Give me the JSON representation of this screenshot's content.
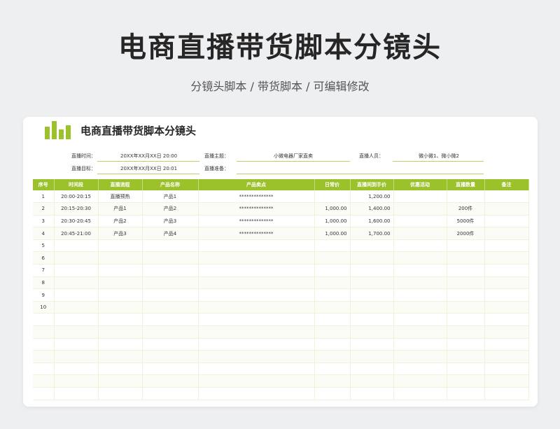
{
  "page": {
    "title": "电商直播带货脚本分镜头",
    "subtitle": "分镜头脚本  /  带货脚本  /  可编辑修改"
  },
  "card": {
    "title": "电商直播带货脚本分镜头",
    "accent_color": "#9bc12b"
  },
  "info": {
    "time_label": "直播时间：",
    "time_value": "20XX年XX月XX日   20:00",
    "theme_label": "直播主题：",
    "theme_value": "小微电器厂家直卖",
    "staff_label": "直播人员：",
    "staff_value": "微小微1、微小微2",
    "target_label": "直播目标：",
    "target_value": "20XX年XX月XX日   20:01",
    "prep_label": "直播准备：",
    "prep_value": ""
  },
  "table": {
    "headers": [
      "序号",
      "时间段",
      "直播流程",
      "产品名称",
      "产品卖点",
      "日常价",
      "直播间到手价",
      "优惠活动",
      "直播数量",
      "备注"
    ],
    "rows": [
      [
        "1",
        "20:00-20:15",
        "直播预热",
        "产品1",
        "**************",
        "",
        "1,200.00",
        "",
        "",
        ""
      ],
      [
        "2",
        "20:15-20:30",
        "产品1",
        "产品2",
        "**************",
        "1,000.00",
        "1,400.00",
        "",
        "200件",
        ""
      ],
      [
        "3",
        "20:30-20:45",
        "产品2",
        "产品3",
        "**************",
        "1,000.00",
        "1,600.00",
        "",
        "5000件",
        ""
      ],
      [
        "4",
        "20:45-21:00",
        "产品3",
        "产品4",
        "**************",
        "1,000.00",
        "1,700.00",
        "",
        "2000件",
        ""
      ],
      [
        "5",
        "",
        "",
        "",
        "",
        "",
        "",
        "",
        "",
        ""
      ],
      [
        "6",
        "",
        "",
        "",
        "",
        "",
        "",
        "",
        "",
        ""
      ],
      [
        "7",
        "",
        "",
        "",
        "",
        "",
        "",
        "",
        "",
        ""
      ],
      [
        "8",
        "",
        "",
        "",
        "",
        "",
        "",
        "",
        "",
        ""
      ],
      [
        "9",
        "",
        "",
        "",
        "",
        "",
        "",
        "",
        "",
        ""
      ],
      [
        "10",
        "",
        "",
        "",
        "",
        "",
        "",
        "",
        "",
        ""
      ],
      [
        "",
        "",
        "",
        "",
        "",
        "",
        "",
        "",
        "",
        ""
      ],
      [
        "",
        "",
        "",
        "",
        "",
        "",
        "",
        "",
        "",
        ""
      ],
      [
        "",
        "",
        "",
        "",
        "",
        "",
        "",
        "",
        "",
        ""
      ],
      [
        "",
        "",
        "",
        "",
        "",
        "",
        "",
        "",
        "",
        ""
      ],
      [
        "",
        "",
        "",
        "",
        "",
        "",
        "",
        "",
        "",
        ""
      ],
      [
        "",
        "",
        "",
        "",
        "",
        "",
        "",
        "",
        "",
        ""
      ],
      [
        "",
        "",
        "",
        "",
        "",
        "",
        "",
        "",
        "",
        ""
      ]
    ]
  }
}
